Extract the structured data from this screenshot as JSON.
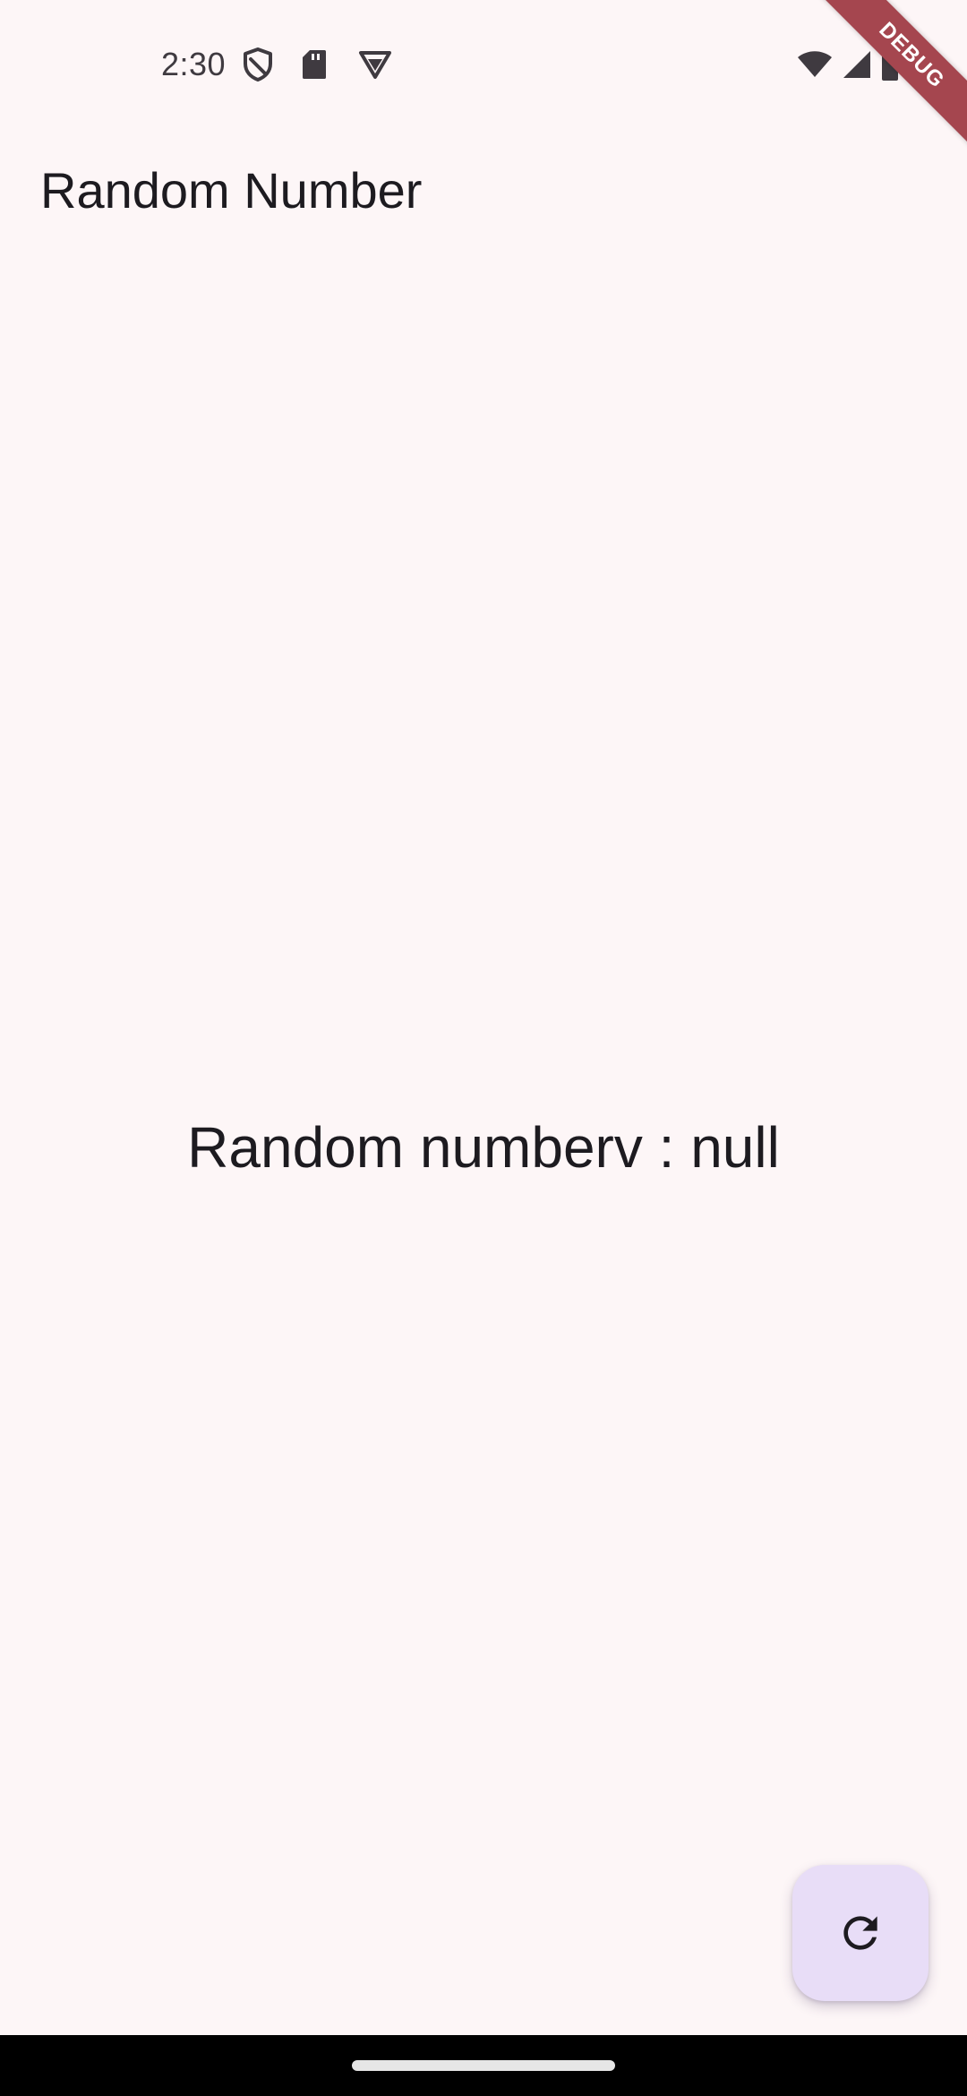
{
  "status_bar": {
    "time": "2:30",
    "left_icons": [
      "shield-icon",
      "sd-card-icon",
      "vpn-icon"
    ],
    "right_icons": [
      "wifi-icon",
      "cell-signal-icon",
      "battery-icon"
    ]
  },
  "debug_banner": {
    "label": "DEBUG",
    "color": "#a5464f"
  },
  "app_bar": {
    "title": "Random Number"
  },
  "main": {
    "text": "Random numberv : null"
  },
  "fab": {
    "icon": "refresh-icon",
    "background": "#e8ddf7"
  },
  "colors": {
    "background": "#fdf6f7",
    "text": "#1d1b20"
  }
}
